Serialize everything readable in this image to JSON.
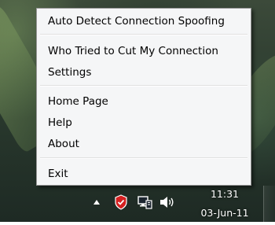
{
  "menu": {
    "items": [
      {
        "id": "auto-detect",
        "label": "Auto Detect Connection Spoofing"
      },
      {
        "id": "who-tried",
        "label": "Who Tried to Cut My Connection"
      },
      {
        "id": "settings",
        "label": "Settings"
      },
      {
        "id": "home-page",
        "label": "Home Page"
      },
      {
        "id": "help",
        "label": "Help"
      },
      {
        "id": "about",
        "label": "About"
      },
      {
        "id": "exit",
        "label": "Exit"
      }
    ]
  },
  "taskbar": {
    "tray_icons": [
      "chevron-up-icon",
      "shield-icon",
      "network-icon",
      "volume-icon"
    ],
    "clock": {
      "time": "11:31",
      "date": "03-Jun-11"
    }
  },
  "colors": {
    "menu_background": "#f5f6f7",
    "shield_red": "#d42020"
  }
}
